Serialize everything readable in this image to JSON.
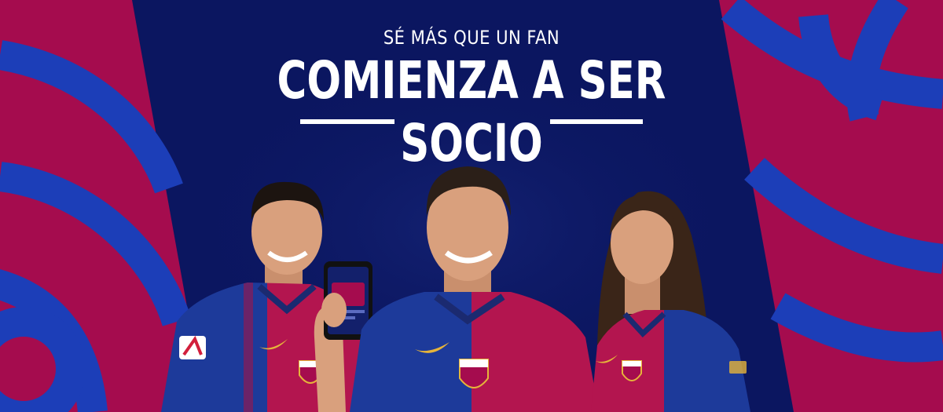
{
  "banner": {
    "kicker": "SÉ MÁS QUE UN FAN",
    "title_line1": "COMIENZA A SER",
    "title_line2": "SOCIO"
  },
  "colors": {
    "navy": "#0b1660",
    "blue": "#1c3eb8",
    "crimson": "#a50c4e",
    "gold": "#e6b43a"
  },
  "icons": [
    "barca-crest-icon",
    "nike-swoosh-icon",
    "smartphone-icon",
    "laliga-badge-icon"
  ]
}
